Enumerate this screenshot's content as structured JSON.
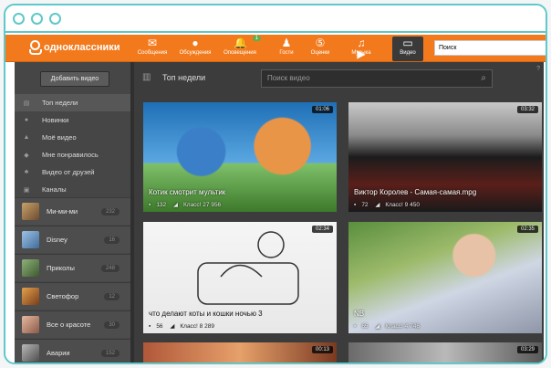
{
  "nav": {
    "logo": "одноклассники",
    "items": [
      {
        "label": "Сообщения",
        "icon": "envelope-icon"
      },
      {
        "label": "Обсуждения",
        "icon": "chat-bubbles-icon"
      },
      {
        "label": "Оповещения",
        "icon": "bell-icon",
        "badge": "1"
      },
      {
        "label": "Гости",
        "icon": "footprints-icon"
      },
      {
        "label": "Оценки",
        "icon": "rating-5-icon"
      },
      {
        "label": "Музыка",
        "icon": "music-note-icon"
      },
      {
        "label": "Видео",
        "icon": "video-icon",
        "active": true
      }
    ],
    "search_placeholder": "Поиск"
  },
  "sidebar": {
    "add_button": "Добавить видео",
    "menu": [
      {
        "label": "Топ недели",
        "active": true
      },
      {
        "label": "Новинки"
      },
      {
        "label": "Моё видео"
      },
      {
        "label": "Мне понравилось"
      },
      {
        "label": "Видео от друзей"
      },
      {
        "label": "Каналы"
      }
    ],
    "channels": [
      {
        "name": "Ми-ми-ми",
        "count": "232"
      },
      {
        "name": "Disney",
        "count": "16"
      },
      {
        "name": "Приколы",
        "count": "248"
      },
      {
        "name": "Светофор",
        "count": "12"
      },
      {
        "name": "Все о красоте",
        "count": "30"
      },
      {
        "name": "Аварии",
        "count": "152"
      }
    ]
  },
  "main": {
    "heading": "Топ недели",
    "search_placeholder": "Поиск видео",
    "help": "?",
    "videos": [
      {
        "title": "Котик смотрит мультик",
        "duration": "01:06",
        "comments": "132",
        "likes": "Класс! 27 956"
      },
      {
        "title": "Виктор Королев - Самая-самая.mpg",
        "duration": "03:32",
        "comments": "72",
        "likes": "Класс! 9 450"
      },
      {
        "title": "что делают коты и кошки ночью 3",
        "duration": "02:34",
        "comments": "56",
        "likes": "Класс! 8 289"
      },
      {
        "title": "NB",
        "duration": "02:35",
        "comments": "65",
        "likes": "Класс! 4 746"
      },
      {
        "title": "",
        "duration": "00:13",
        "comments": "",
        "likes": ""
      },
      {
        "title": "",
        "duration": "03:29",
        "comments": "",
        "likes": ""
      }
    ]
  },
  "colors": {
    "brand": "#f27a1d",
    "frame": "#5fc8c8",
    "dark_bg": "#3c3c3c"
  }
}
